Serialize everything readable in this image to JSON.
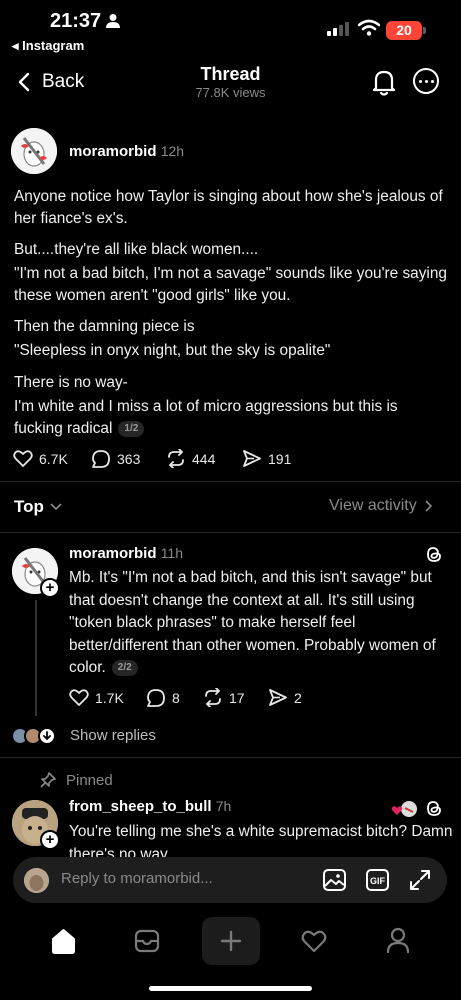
{
  "status_bar": {
    "time": "21:37",
    "back_app": "◂ Instagram",
    "battery": "20"
  },
  "header": {
    "back_label": "Back",
    "title": "Thread",
    "views": "77.8K views"
  },
  "main_post": {
    "username": "moramorbid",
    "time": "12h",
    "paragraphs": [
      "Anyone notice how Taylor is singing about how she's jealous of her fiance's ex's.",
      "But....they're all like black women....",
      "\"I'm not a bad bitch, I'm not a savage\" sounds like you're saying these women aren't \"good girls\" like you.",
      "Then the damning piece is",
      "\"Sleepless in onyx night, but the sky is opalite\"",
      "There is no way-",
      "I'm white and I miss a lot of micro aggressions but this is fucking radical"
    ],
    "page": "1/2",
    "likes": "6.7K",
    "comments": "363",
    "reposts": "444",
    "shares": "191"
  },
  "sort": {
    "label": "Top",
    "view_activity": "View activity"
  },
  "reply": {
    "username": "moramorbid",
    "time": "11h",
    "text": "Mb. It's \"I'm not a bad bitch, and this isn't savage\" but that doesn't change the context at all. It's still using \"token black phrases\" to make herself feel better/different than other women. Probably women of color.",
    "page": "2/2",
    "likes": "1.7K",
    "comments": "8",
    "reposts": "17",
    "shares": "2",
    "show_replies": "Show replies"
  },
  "pinned": {
    "label": "Pinned",
    "username": "from_sheep_to_bull",
    "time": "7h",
    "text": "You're telling me she's a white supremacist bitch? Damn there's no way..."
  },
  "composer": {
    "placeholder": "Reply to moramorbid..."
  },
  "colors": {
    "background": "#000000",
    "muted": "#8a8a8a",
    "divider": "#262626",
    "heart": "#e0245e"
  },
  "icons": [
    "bell-icon",
    "more-icon",
    "heart-icon",
    "comment-icon",
    "repost-icon",
    "share-icon",
    "threads-icon",
    "image-icon",
    "gif-icon",
    "expand-icon",
    "home-icon",
    "inbox-icon",
    "plus-icon",
    "activity-icon",
    "profile-icon"
  ]
}
